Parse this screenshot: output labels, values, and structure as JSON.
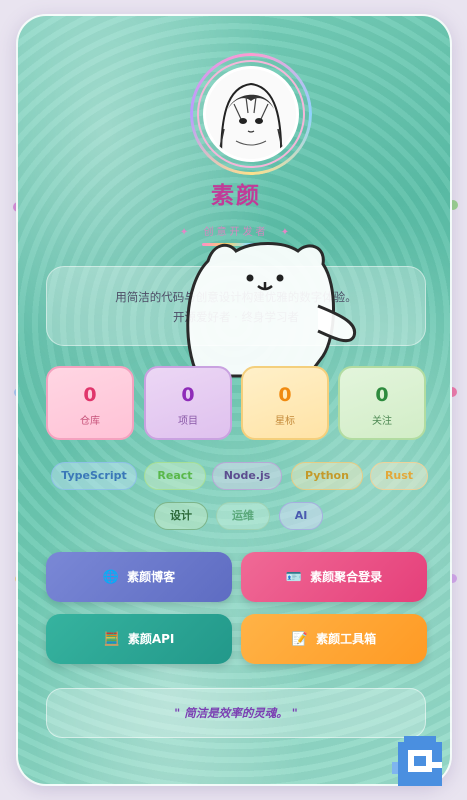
{
  "profile": {
    "name": "素颜",
    "subtitle": "创意开发者",
    "bio_line1": "用简洁的代码与创意设计构建优雅的数字体验。",
    "bio_line2": "开源爱好者 · 终身学习者"
  },
  "stats": [
    {
      "value": "0",
      "label": "仓库",
      "color": "#e0356b"
    },
    {
      "value": "0",
      "label": "项目",
      "color": "#8e2bb8"
    },
    {
      "value": "0",
      "label": "星标",
      "color": "#f08a10"
    },
    {
      "value": "0",
      "label": "关注",
      "color": "#2e8b3e"
    }
  ],
  "tags": [
    "TypeScript",
    "React",
    "Node.js",
    "Python",
    "Rust",
    "设计",
    "运维",
    "AI"
  ],
  "buttons": {
    "blog": "素颜博客",
    "login": "素颜聚合登录",
    "api": "素颜API",
    "tools": "素颜工具箱"
  },
  "quote": "\" 简洁是效率的灵魂。 \"",
  "colors": {
    "accent": "#c13b98",
    "blog_btn": "#6b78cc",
    "login_btn": "#ec4f86",
    "api_btn": "#2aa896",
    "tools_btn": "#ffa531"
  },
  "icons": [
    "globe-icon",
    "id-card-icon",
    "calculator-icon",
    "memo-icon"
  ]
}
